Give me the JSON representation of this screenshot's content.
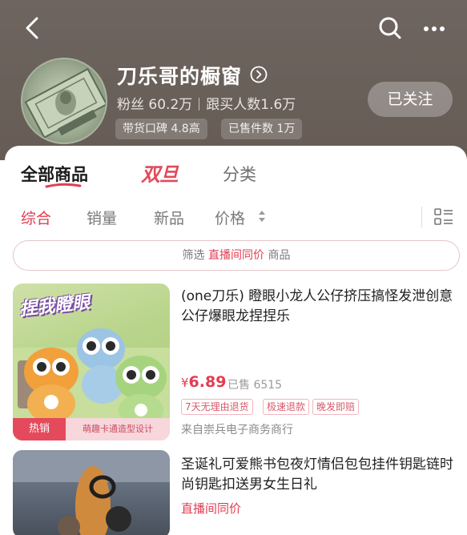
{
  "header": {
    "shop_title": "刀乐哥的橱窗",
    "fans": "粉丝 60.2万",
    "buyers": "跟买人数1.6万",
    "badge_rating": "带货口碑 4.8高",
    "badge_sold": "已售件数 1万",
    "follow_label": "已关注",
    "icons": [
      "back-icon",
      "search-icon",
      "more-icon",
      "chevron-right-icon"
    ]
  },
  "tabs": {
    "all": "全部商品",
    "double": "双旦",
    "category": "分类"
  },
  "sort": {
    "comprehensive": "综合",
    "sales": "销量",
    "new": "新品",
    "price": "价格"
  },
  "filter": {
    "prefix": "筛选",
    "highlight": "直播间同价",
    "suffix": "商品"
  },
  "products": [
    {
      "title": "(one刀乐) 瞪眼小龙人公仔挤压搞怪发泄创意公仔爆眼龙捏捏乐",
      "price_symbol": "¥",
      "price": "6.89",
      "sold": "已售 6515",
      "tags": [
        "7天无理由退货",
        "极速退款",
        "晚发即赔"
      ],
      "store": "来自崇兵电子商务商行",
      "image_headline": "捏我瞪眼",
      "image_hot": "热销",
      "image_caption": "萌趣卡通造型设计"
    },
    {
      "title": "圣诞礼可爱熊书包夜灯情侣包包挂件钥匙链时尚钥匙扣送男女生日礼",
      "live_label": "直播间同价"
    }
  ],
  "colors": {
    "accent": "#e23d52",
    "header_bg": "#6a605a"
  }
}
